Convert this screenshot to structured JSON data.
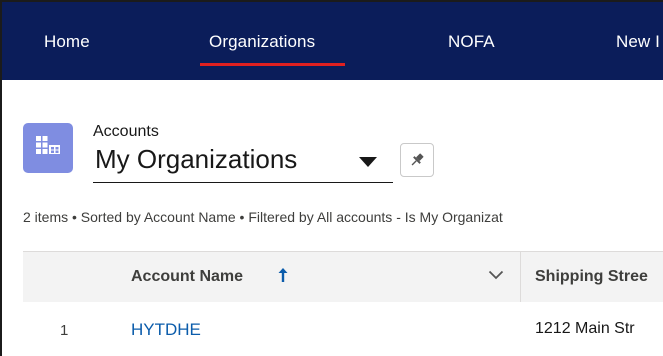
{
  "nav": {
    "items": [
      {
        "label": "Home"
      },
      {
        "label": "Organizations",
        "active": true
      },
      {
        "label": "NOFA"
      },
      {
        "label": "New I"
      }
    ],
    "active_underline_color": "#e02020",
    "background_color": "#0b1d5a"
  },
  "header": {
    "object_label": "Accounts",
    "list_view_name": "My Organizations",
    "icon": "accounts-table-icon",
    "icon_color": "#7f8de1",
    "pin_icon": "pin-icon"
  },
  "list_summary": "2 items • Sorted by Account Name • Filtered by All accounts - Is My Organizat",
  "table": {
    "columns": [
      {
        "label": "Account Name",
        "sort": "ascending"
      },
      {
        "label": "Shipping Stree"
      }
    ],
    "rows": [
      {
        "num": "1",
        "account_name": "HYTDHE",
        "shipping_street": "1212 Main Str"
      }
    ],
    "link_color": "#0b5cab"
  }
}
